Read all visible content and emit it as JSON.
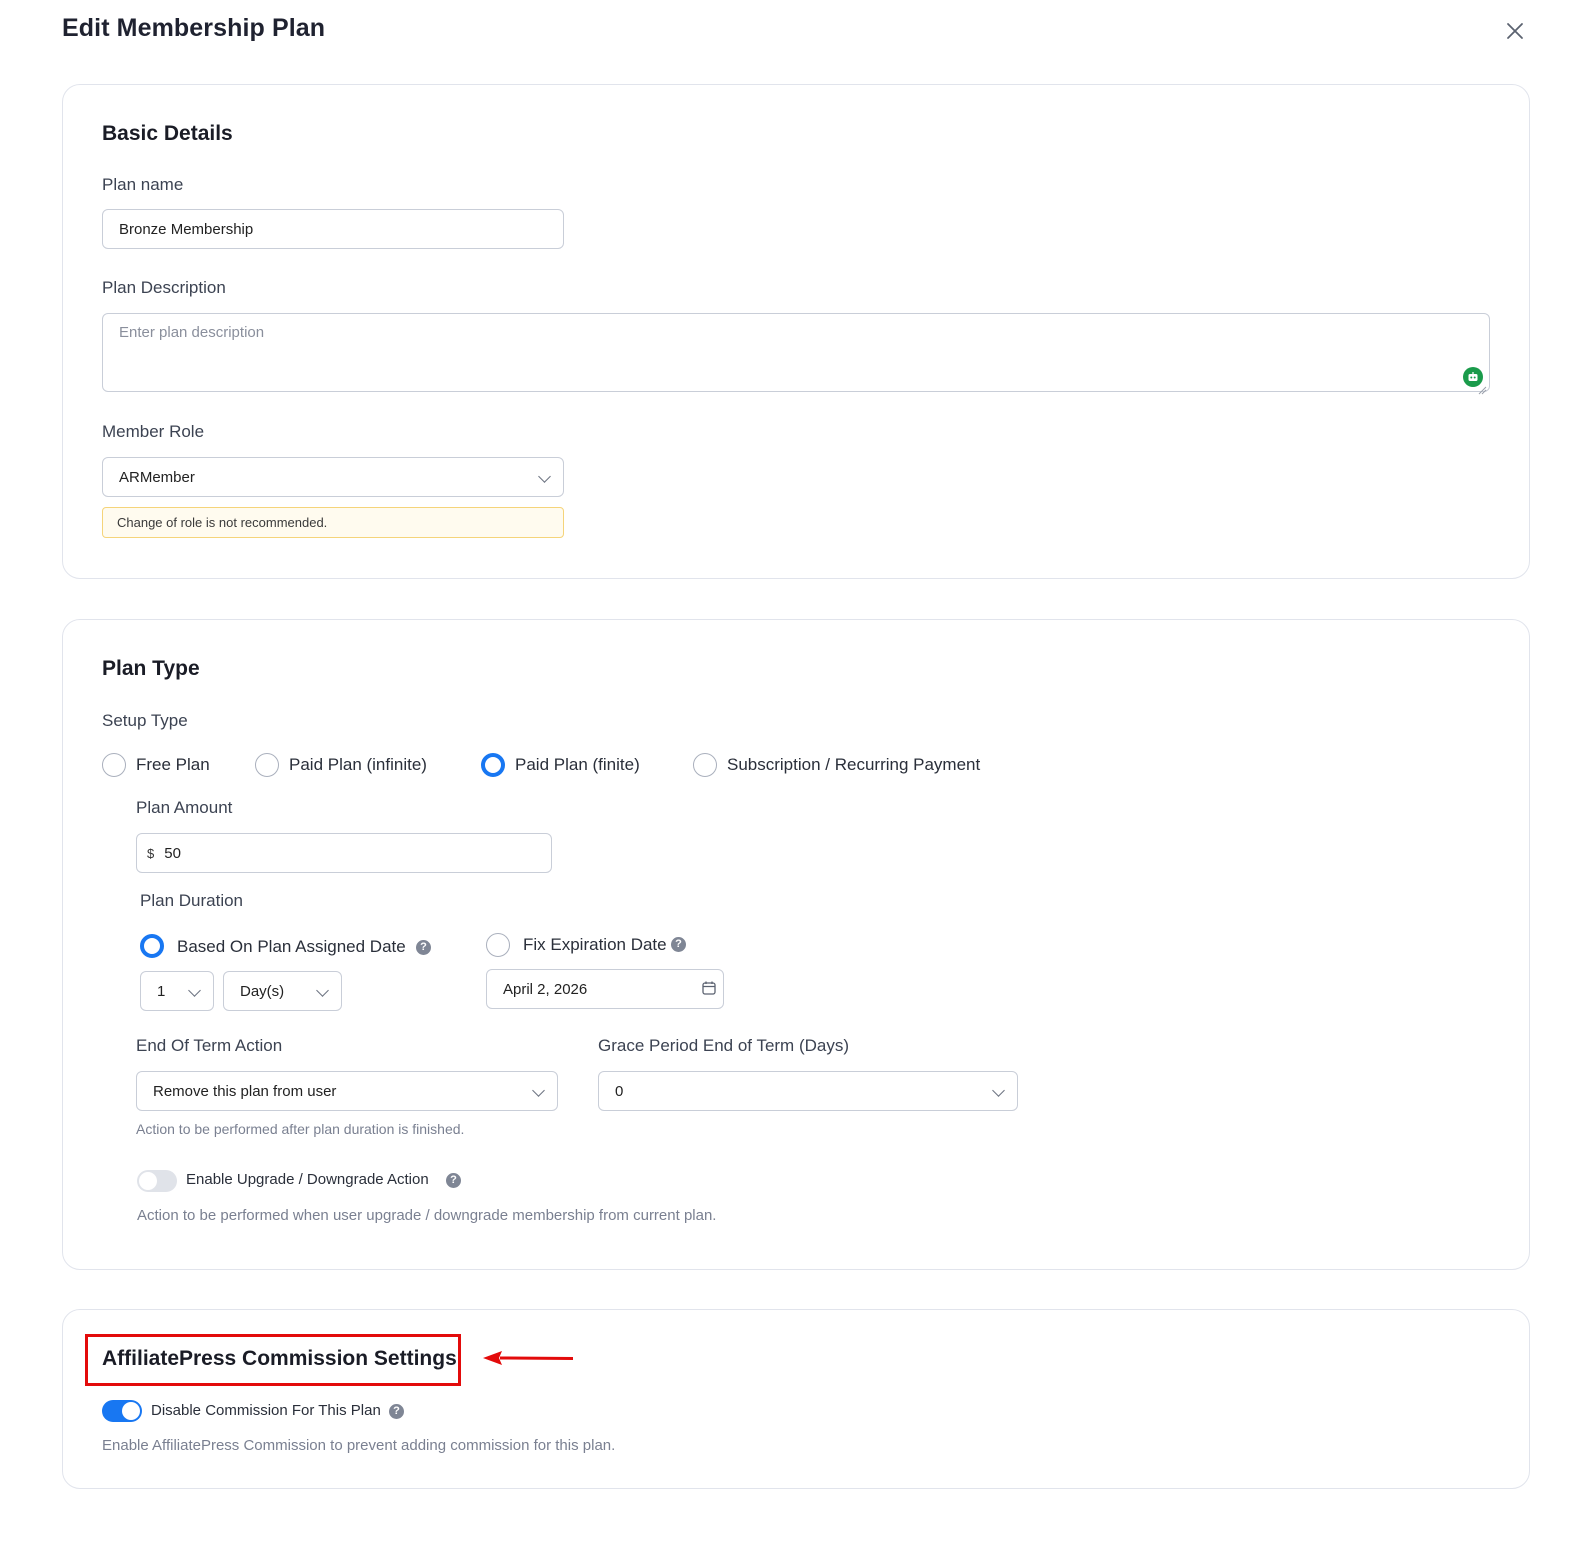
{
  "dialog": {
    "title": "Edit Membership Plan",
    "close_icon": "close-icon"
  },
  "basic_details": {
    "heading": "Basic Details",
    "plan_name_label": "Plan name",
    "plan_name_value": "Bronze Membership",
    "description_label": "Plan Description",
    "description_placeholder": "Enter plan description",
    "member_role_label": "Member Role",
    "member_role_value": "ARMember",
    "role_notice": "Change of role is not recommended."
  },
  "plan_type": {
    "heading": "Plan Type",
    "setup_type_label": "Setup Type",
    "options": [
      {
        "label": "Free Plan",
        "selected": false
      },
      {
        "label": "Paid Plan (infinite)",
        "selected": false
      },
      {
        "label": "Paid Plan (finite)",
        "selected": true
      },
      {
        "label": "Subscription / Recurring Payment",
        "selected": false
      }
    ],
    "plan_amount_label": "Plan Amount",
    "currency_symbol": "$",
    "plan_amount_value": "50",
    "plan_duration_label": "Plan Duration",
    "duration_options": [
      {
        "label": "Based On Plan Assigned Date",
        "selected": true
      },
      {
        "label": "Fix Expiration Date",
        "selected": false
      }
    ],
    "duration_count": "1",
    "duration_unit": "Day(s)",
    "expiration_date": "April 2, 2026",
    "end_of_term_label": "End Of Term Action",
    "end_of_term_value": "Remove this plan from user",
    "end_of_term_hint": "Action to be performed after plan duration is finished.",
    "grace_period_label": "Grace Period End of Term (Days)",
    "grace_period_value": "0",
    "upgrade_toggle_label": "Enable Upgrade / Downgrade Action",
    "upgrade_toggle_on": false,
    "upgrade_hint": "Action to be performed when user upgrade / downgrade membership from current plan."
  },
  "affiliate": {
    "heading": "AffiliatePress Commission Settings",
    "toggle_label": "Disable Commission For This Plan",
    "toggle_on": true,
    "hint": "Enable AffiliatePress Commission to prevent adding commission for this plan."
  },
  "colors": {
    "accent": "#1877f2",
    "highlight": "#e30b0b",
    "notice_bg": "#fffbef",
    "notice_border": "#f5d47a"
  }
}
